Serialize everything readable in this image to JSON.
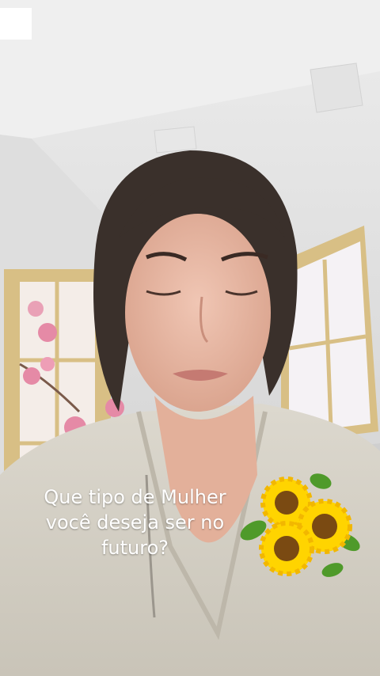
{
  "caption": {
    "line1": "Que tipo de Mulher",
    "line2": "você deseja ser no",
    "line3": "futuro?"
  },
  "colors": {
    "wall": "#e6e6e6",
    "ceiling": "#eeeeee",
    "screen_frame": "#d9c08a",
    "sakura": "#e58aa6",
    "robe": "#d8d3c8",
    "hair": "#3a302b",
    "skin": "#e8b9a5",
    "sunflower_petal": "#ffd400",
    "sunflower_center": "#7a4a12",
    "leaf": "#4f9a2a"
  },
  "sticker": {
    "icon": "sunflower-sticker-icon"
  }
}
